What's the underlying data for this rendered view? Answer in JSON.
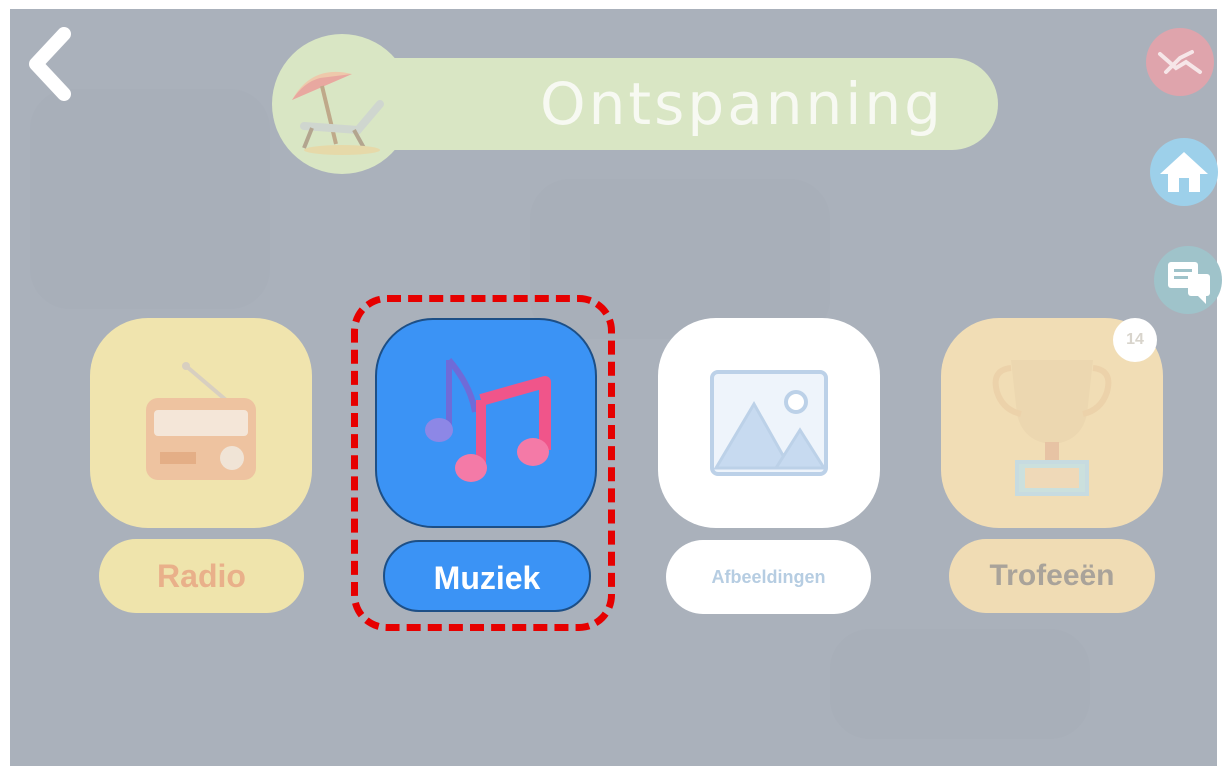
{
  "header": {
    "title": "Ontspanning",
    "title_icon": "beach-chair-umbrella-icon",
    "back_icon": "chevron-left-icon"
  },
  "side_buttons": [
    {
      "name": "help",
      "icon": "handshake-icon",
      "color": "#dfa4ac"
    },
    {
      "name": "home",
      "icon": "home-icon",
      "color": "#9dd0ea"
    },
    {
      "name": "chat",
      "icon": "chat-bubbles-icon",
      "color": "#9fc3ca"
    }
  ],
  "tiles": [
    {
      "label": "Radio",
      "icon": "radio-icon",
      "color": "#f0e4ae"
    },
    {
      "label": "Muziek",
      "icon": "music-notes-icon",
      "color": "#3b93f5",
      "selected": true
    },
    {
      "label": "Afbeeldingen",
      "icon": "image-icon",
      "color": "#ffffff"
    },
    {
      "label": "Trofeeën",
      "icon": "trophy-icon",
      "color": "#f1ddb5",
      "badge": "14"
    }
  ],
  "colors": {
    "overlay": "#aab1bb",
    "highlight": "#e60000",
    "accent": "#3b93f5"
  }
}
